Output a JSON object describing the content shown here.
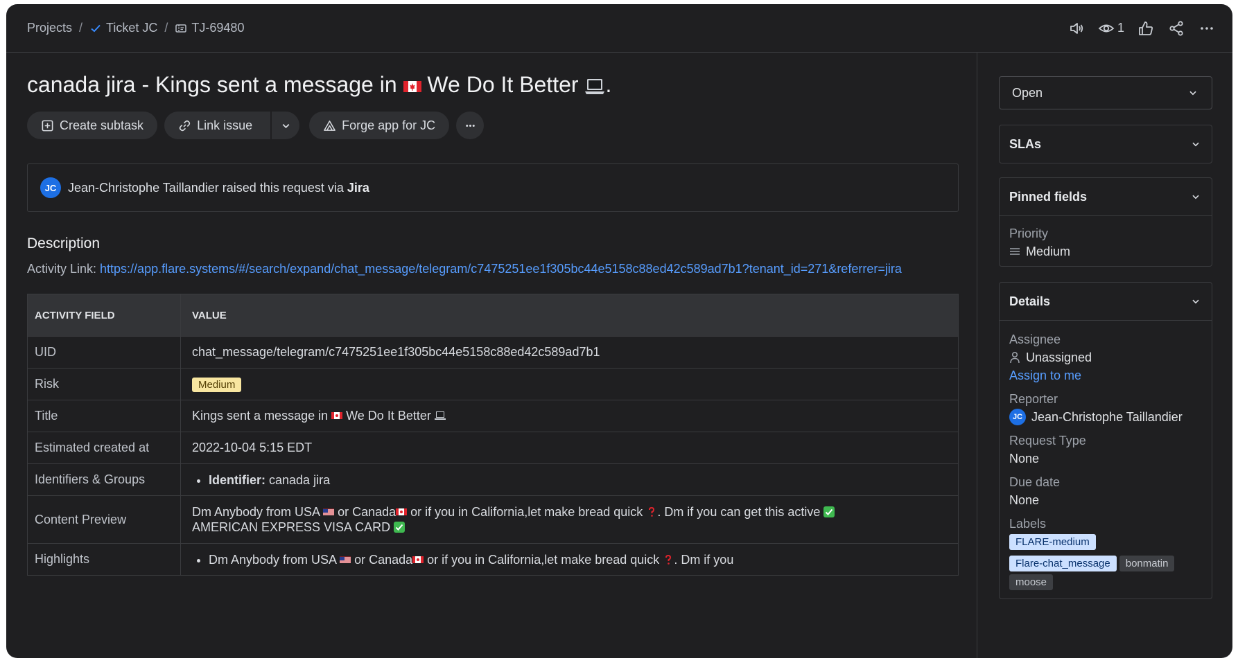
{
  "breadcrumb": {
    "projects": "Projects",
    "ticket": "Ticket JC",
    "key": "TJ-69480",
    "separator": "/"
  },
  "topbar": {
    "watch_count": "1"
  },
  "issue": {
    "title_before_flag": "canada jira - Kings sent a message in ",
    "title_after_flag": " We Do It Better ",
    "title_end": "."
  },
  "toolbar": {
    "create_subtask": "Create subtask",
    "link_issue": "Link issue",
    "forge_app": "Forge app for JC"
  },
  "raised": {
    "avatar": "JC",
    "text": "Jean-Christophe Taillandier raised this request via ",
    "channel": "Jira"
  },
  "description": {
    "heading": "Description",
    "activity_label": "Activity Link: ",
    "activity_url": "https://app.flare.systems/#/search/expand/chat_message/telegram/c7475251ee1f305bc44e5158c88ed42c589ad7b1?tenant_id=271&referrer=jira"
  },
  "table": {
    "headers": [
      "ACTIVITY FIELD",
      "VALUE"
    ],
    "rows": {
      "uid": {
        "key": "UID",
        "value": "chat_message/telegram/c7475251ee1f305bc44e5158c88ed42c589ad7b1"
      },
      "risk": {
        "key": "Risk",
        "value": "Medium"
      },
      "title": {
        "key": "Title",
        "value_before": "Kings sent a message in ",
        "value_after": " We Do It Better "
      },
      "created": {
        "key": "Estimated created at",
        "value": "2022-10-04 5:15 EDT"
      },
      "identifiers": {
        "key": "Identifiers & Groups",
        "label": "Identifier:",
        "value": " canada jira"
      },
      "preview": {
        "key": "Content Preview",
        "line1_a": "Dm Anybody from USA ",
        "line1_b": " or Canada",
        "line1_c": " or if you in California,let make bread quick ",
        "line1_d": ". Dm if you can get this active ",
        "line2": "AMERICAN EXPRESS VISA CARD "
      },
      "highlights": {
        "key": "Highlights",
        "a": "Dm Anybody from USA ",
        "b": " or Canada",
        "c": " or if you in California,let make bread quick ",
        "d": ". Dm if you"
      }
    }
  },
  "sidebar": {
    "status": "Open",
    "slas": "SLAs",
    "pinned": {
      "heading": "Pinned fields",
      "priority_label": "Priority",
      "priority_value": "Medium"
    },
    "details": {
      "heading": "Details",
      "assignee_label": "Assignee",
      "assignee_value": "Unassigned",
      "assign_to_me": "Assign to me",
      "reporter_label": "Reporter",
      "reporter_avatar": "JC",
      "reporter_value": "Jean-Christophe Taillandier",
      "request_type_label": "Request Type",
      "request_type_value": "None",
      "due_label": "Due date",
      "due_value": "None",
      "labels_label": "Labels",
      "labels": [
        "FLARE-medium",
        "Flare-chat_message",
        "bonmatin",
        "moose"
      ]
    }
  },
  "colors": {
    "background": "#1f1f21",
    "link": "#579dff",
    "badge": "#f8e6a0",
    "label_blue": "#cce0ff"
  }
}
